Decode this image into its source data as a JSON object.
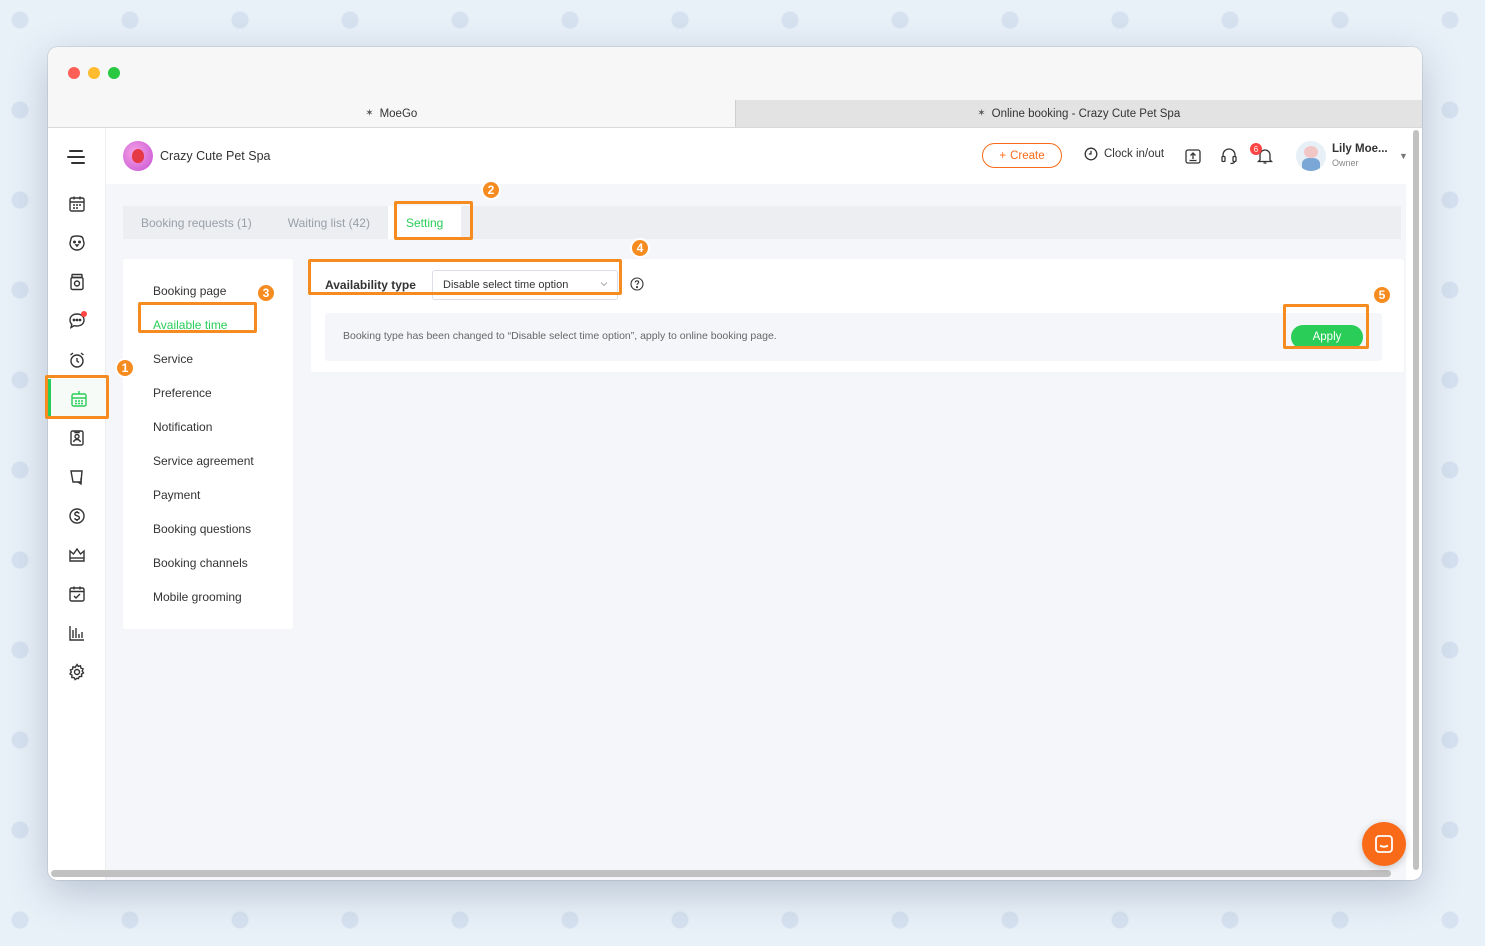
{
  "browser": {
    "tabs": [
      {
        "title": "MoeGo",
        "active": true
      },
      {
        "title": "Online booking - Crazy Cute Pet Spa",
        "active": false
      }
    ]
  },
  "header": {
    "business_name": "Crazy Cute Pet Spa",
    "create_label": "Create",
    "clock_label": "Clock in/out",
    "notification_count": "6",
    "user_name": "Lily Moe...",
    "user_role": "Owner"
  },
  "sidebar": {
    "icons": [
      "calendar-icon",
      "pet-face-icon",
      "food-jar-icon",
      "chat-bubble-icon",
      "alarm-clock-icon",
      "online-booking-icon",
      "contact-card-icon",
      "retail-bag-icon",
      "dollar-icon",
      "crown-icon",
      "agreement-icon",
      "report-chart-icon",
      "gear-icon"
    ],
    "active": "online-booking-icon"
  },
  "page_tabs": [
    {
      "label": "Booking requests (1)",
      "active": false
    },
    {
      "label": "Waiting list (42)",
      "active": false
    },
    {
      "label": "Setting",
      "active": true
    }
  ],
  "settings_menu": [
    {
      "label": "Booking page",
      "active": false
    },
    {
      "label": "Available time",
      "active": true
    },
    {
      "label": "Service",
      "active": false
    },
    {
      "label": "Preference",
      "active": false
    },
    {
      "label": "Notification",
      "active": false
    },
    {
      "label": "Service agreement",
      "active": false
    },
    {
      "label": "Payment",
      "active": false
    },
    {
      "label": "Booking questions",
      "active": false
    },
    {
      "label": "Booking channels",
      "active": false
    },
    {
      "label": "Mobile grooming",
      "active": false
    }
  ],
  "availability": {
    "label": "Availability type",
    "selected": "Disable select time option"
  },
  "notice": {
    "text": "Booking type has been changed to “Disable select time option”, apply to online booking page.",
    "apply_label": "Apply"
  },
  "markers": [
    "1",
    "2",
    "3",
    "4",
    "5"
  ],
  "colors": {
    "accent_green": "#29cd57",
    "accent_orange": "#f96b18",
    "highlight_orange": "#f68b1f"
  }
}
